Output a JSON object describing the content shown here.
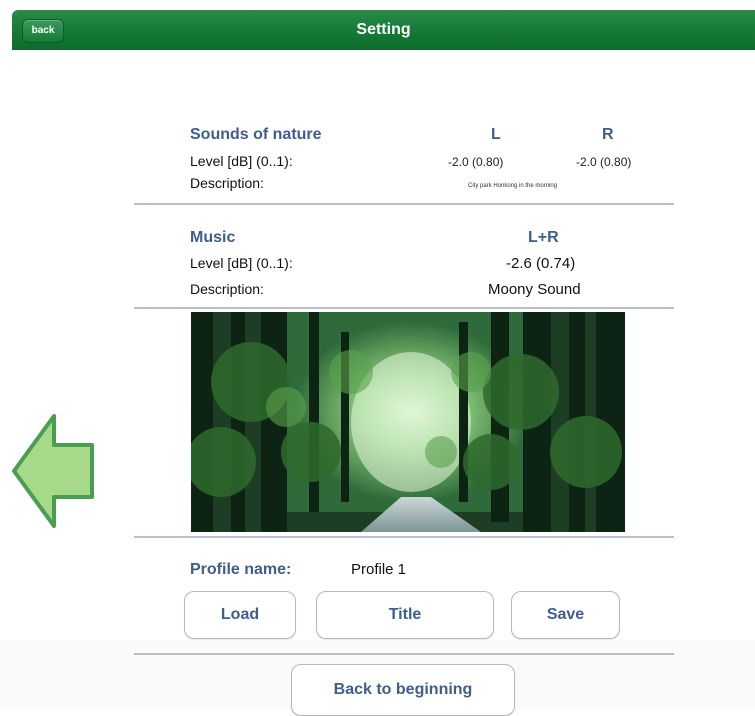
{
  "header": {
    "back_label": "back",
    "title": "Setting"
  },
  "nature": {
    "title": "Sounds of nature",
    "col_left": "L",
    "col_right": "R",
    "level_label": "Level [dB] (0..1):",
    "level_left": "-2.0 (0.80)",
    "level_right": "-2.0 (0.80)",
    "description_label": "Description:",
    "description_value": "City park Honkong in the morning"
  },
  "music": {
    "title": "Music",
    "col_label": "L+R",
    "level_label": "Level [dB] (0..1):",
    "level_value": "-2.6 (0.74)",
    "description_label": "Description:",
    "description_value": "Moony Sound"
  },
  "profile": {
    "label": "Profile name:",
    "value": "Profile 1"
  },
  "buttons": {
    "load": "Load",
    "title": "Title",
    "save": "Save",
    "back_to_beginning": "Back to beginning"
  },
  "colors": {
    "header_green": "#157a35",
    "accent_blue": "#3f5d8f",
    "arrow_fill": "#a6d98a",
    "arrow_stroke": "#4a9e4f"
  },
  "icons": {
    "left_arrow": "left-arrow-icon"
  }
}
